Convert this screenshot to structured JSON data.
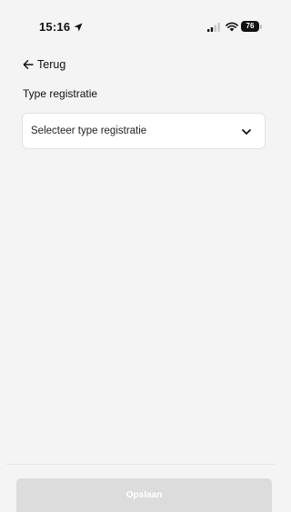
{
  "status_bar": {
    "time": "15:16",
    "battery_level": "76",
    "icons": [
      "location-arrow-icon",
      "signal-icon",
      "wifi-icon",
      "battery-icon"
    ]
  },
  "navigation": {
    "back_label": "Terug",
    "back_icon": "arrow-left-icon"
  },
  "form": {
    "type_label": "Type registratie",
    "type_select": {
      "selected_text": "Selecteer type registratie",
      "icon": "chevron-down-icon"
    }
  },
  "footer": {
    "save_label": "Opslaan",
    "save_enabled": false
  },
  "colors": {
    "background": "#f4f4f4",
    "card": "#ffffff",
    "disabled_button": "#dcdcdc"
  }
}
